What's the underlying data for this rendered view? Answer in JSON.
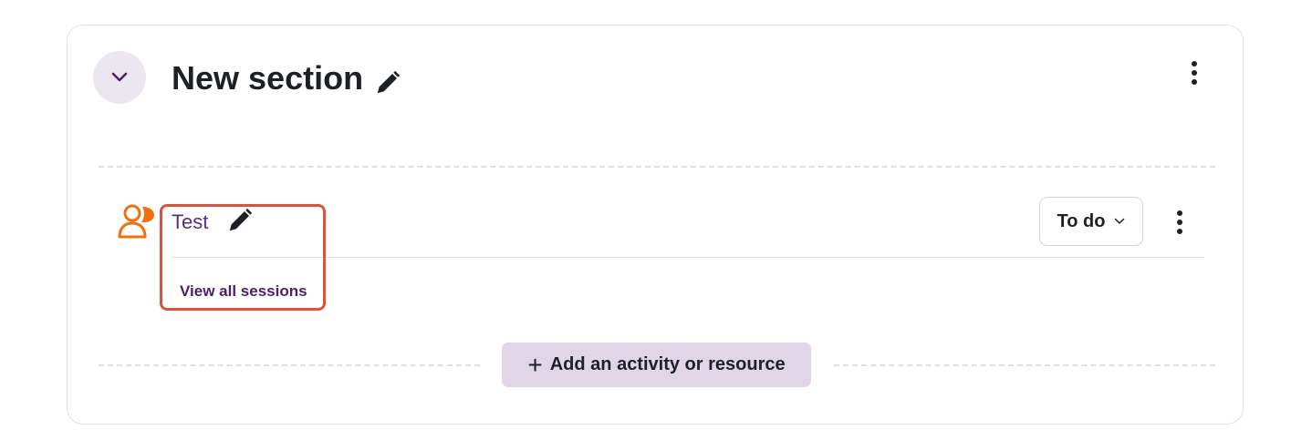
{
  "section": {
    "title": "New section",
    "collapse_icon": "chevron-down-icon",
    "edit_icon": "pencil-icon",
    "menu_icon": "kebab-menu-icon"
  },
  "activity": {
    "name": "Test",
    "icon": "face-to-face-icon",
    "edit_icon": "pencil-icon",
    "link_label": "View all sessions",
    "completion": {
      "label": "To do",
      "icon": "chevron-down-icon"
    },
    "menu_icon": "kebab-menu-icon"
  },
  "add_button": {
    "plus": "+",
    "label": "Add an activity or resource"
  },
  "colors": {
    "accent": "#5b2d83",
    "activity_icon": "#f07010",
    "highlight": "#d9533e",
    "add_button_bg": "#e0d6e5",
    "collapse_bg": "#ece6f0"
  }
}
